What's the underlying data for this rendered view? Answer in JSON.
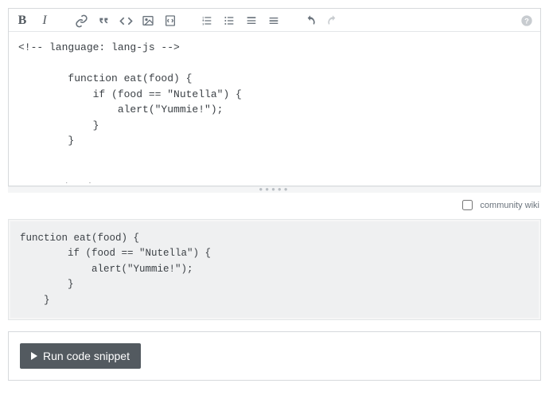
{
  "toolbar": {
    "bold_glyph": "B",
    "italic_glyph": "I"
  },
  "editor": {
    "content": "<!-- language: lang-js -->\n\n        function eat(food) {\n            if (food == \"Nutella\") {\n                alert(\"Yummie!\");\n            }\n        }\n\n\n<!-- end snippet -->"
  },
  "community_wiki": {
    "label": "community wiki",
    "checked": false
  },
  "preview": {
    "code": "function eat(food) {\n        if (food == \"Nutella\") {\n            alert(\"Yummie!\");\n        }\n    }"
  },
  "run": {
    "label": "Run code snippet"
  },
  "grabber_dots": "●●●●●"
}
